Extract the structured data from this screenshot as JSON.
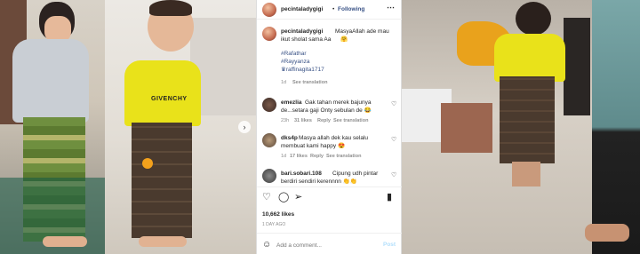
{
  "post": {
    "username": "pecintaladygigi",
    "separator": "•",
    "follow_label": "Following",
    "more_icon": "more-dots-icon"
  },
  "caption": {
    "username": "pecintaladygigi",
    "line1": "MasyaAllah ade mau",
    "line2": "ikut sholat sama Aa",
    "emoji": "🤗",
    "tag1": "#Rafathar",
    "tag2": "#Rayyanza",
    "tag3": "♛raffinagita1717",
    "time": "1d",
    "see_translation": "See translation"
  },
  "comments": [
    {
      "username": "emezlia",
      "line1": "Gak tahan merek bajunya",
      "line2": "de...setara gaji Onty sebulan de 😂",
      "time": "23h",
      "likes": "31 likes",
      "reply": "Reply",
      "see_translation": "See translation"
    },
    {
      "username": "dks4p",
      "line1": "Masya allah dek kau selalu",
      "line2": "membuat kami happy 😍",
      "time": "1d",
      "likes": "17 likes",
      "reply": "Reply",
      "see_translation": "See translation"
    },
    {
      "username": "bari.sobari.108",
      "line1": "Cipung udh pintar",
      "line2": "berdiri sendiri kerennnn 👏👏",
      "time": "",
      "likes": "",
      "reply": "",
      "see_translation": ""
    }
  ],
  "stats": {
    "likes": "10,662 likes",
    "date": "1 DAY AGO"
  },
  "input": {
    "placeholder": "Add a comment...",
    "post_label": "Post",
    "emoji_icon": "emoji-icon"
  },
  "image_text": {
    "shirt_brand": "GIVENCHY"
  },
  "colors": {
    "shirt_yellow": "#e9e21a",
    "link_blue": "#385185",
    "post_button": "#b2dffc"
  }
}
